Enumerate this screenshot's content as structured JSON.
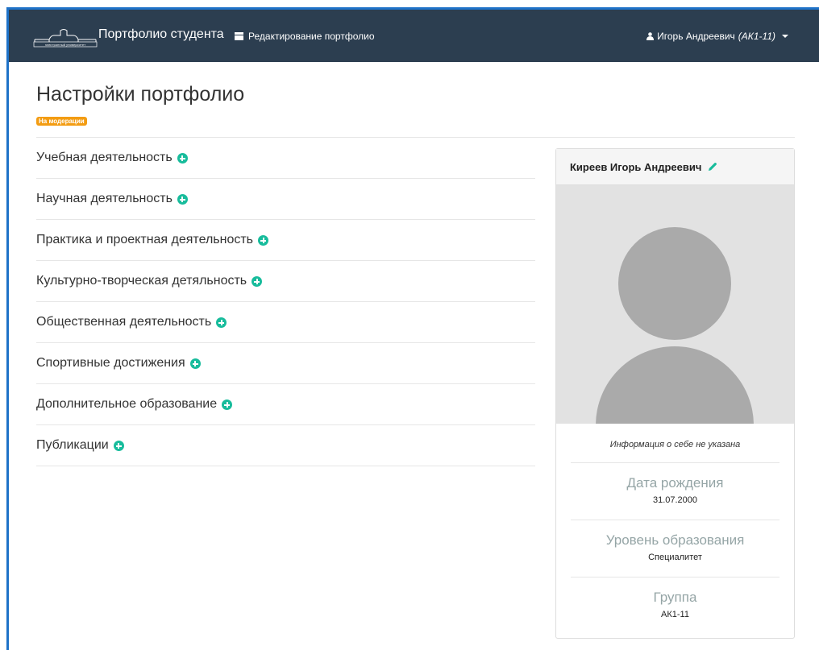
{
  "navbar": {
    "brand_title": "Портфолио студента",
    "logo_caption": "электронный университет",
    "edit_link": "Редактирование портфолио",
    "user_name": "Игорь Андреевич",
    "user_group": "(АК1-11)"
  },
  "page": {
    "title": "Настройки портфолио",
    "status": "На модерации"
  },
  "sections": [
    {
      "label": "Учебная деятельность"
    },
    {
      "label": "Научная деятельность"
    },
    {
      "label": "Практика и проектная деятельность"
    },
    {
      "label": "Культурно-творческая детяльность"
    },
    {
      "label": "Общественная деятельность"
    },
    {
      "label": "Спортивные достижения"
    },
    {
      "label": "Дополнительное образование"
    },
    {
      "label": "Публикации"
    }
  ],
  "profile": {
    "full_name": "Киреев Игорь Андреевич",
    "about": "Информация о себе не указана",
    "birth_label": "Дата рождения",
    "birth_value": "31.07.2000",
    "education_label": "Уровень образования",
    "education_value": "Специалитет",
    "group_label": "Группа",
    "group_value": "АК1-11"
  },
  "colors": {
    "navbar": "#2c3e50",
    "accent_add": "#18bc9c",
    "status_badge": "#f39c12",
    "frame": "#1e72c8"
  },
  "icons": [
    "logo-icon",
    "document-icon",
    "user-icon",
    "caret-down-icon",
    "plus-circle-icon",
    "pencil-icon"
  ]
}
